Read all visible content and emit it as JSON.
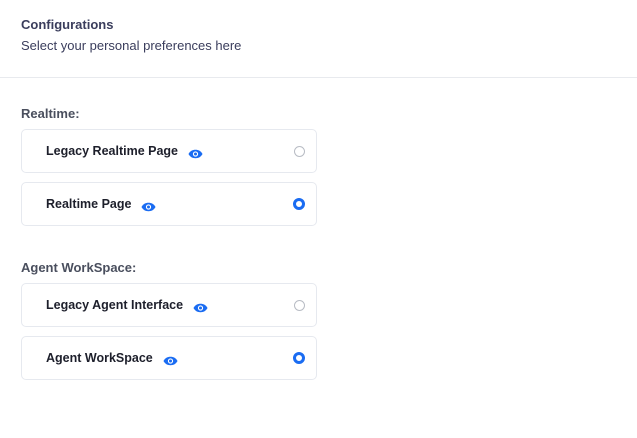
{
  "header": {
    "title": "Configurations",
    "subtitle": "Select your personal preferences here"
  },
  "sections": [
    {
      "label": "Realtime:",
      "options": [
        {
          "label": "Legacy Realtime Page",
          "selected": false
        },
        {
          "label": "Realtime Page",
          "selected": true
        }
      ]
    },
    {
      "label": "Agent WorkSpace:",
      "options": [
        {
          "label": "Legacy Agent Interface",
          "selected": false
        },
        {
          "label": "Agent WorkSpace",
          "selected": true
        }
      ]
    }
  ],
  "colors": {
    "accent": "#1a6cf2"
  }
}
